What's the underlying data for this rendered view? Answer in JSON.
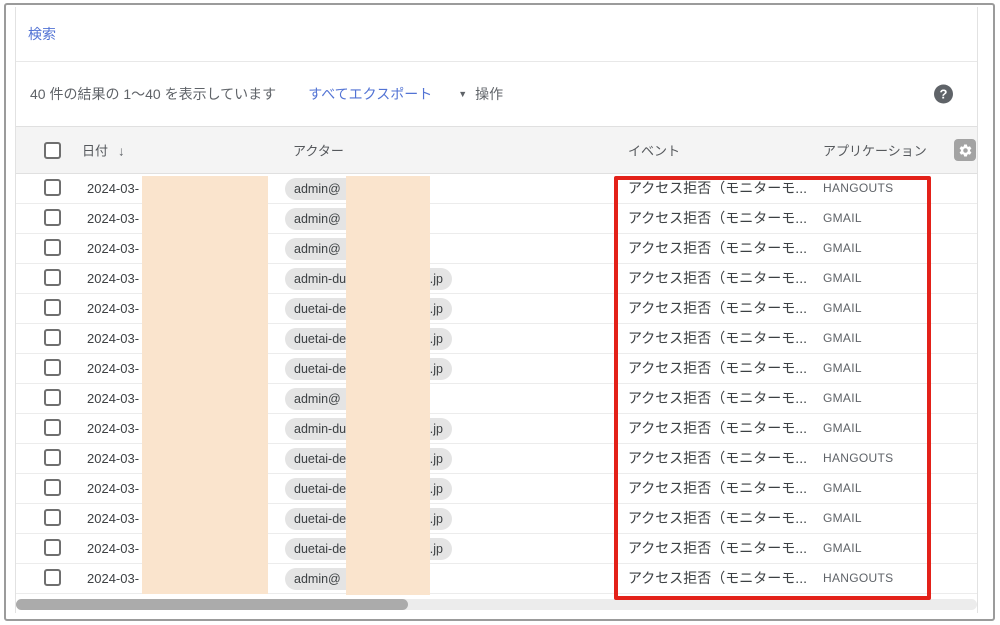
{
  "search": {
    "label": "検索"
  },
  "toolbar": {
    "results_text": "40 件の結果の 1～40 を表示しています",
    "export_label": "すべてエクスポート",
    "actions_label": "操作",
    "caret_glyph": "▼",
    "help_glyph": "?"
  },
  "table": {
    "headers": {
      "date": "日付",
      "actor": "アクター",
      "event": "イベント",
      "app": "アプリケーション"
    },
    "sort_glyph": "↓",
    "rows": [
      {
        "date": "2024-03-",
        "actor": "admin@",
        "suffix": "",
        "event": "アクセス拒否（モニターモ...",
        "app": "HANGOUTS"
      },
      {
        "date": "2024-03-",
        "actor": "admin@",
        "suffix": "",
        "event": "アクセス拒否（モニターモ...",
        "app": "GMAIL"
      },
      {
        "date": "2024-03-",
        "actor": "admin@",
        "suffix": "",
        "event": "アクセス拒否（モニターモ...",
        "app": "GMAIL"
      },
      {
        "date": "2024-03-",
        "actor": "admin-du",
        "suffix": ".jp",
        "event": "アクセス拒否（モニターモ...",
        "app": "GMAIL"
      },
      {
        "date": "2024-03-",
        "actor": "duetai-de",
        "suffix": ".jp",
        "event": "アクセス拒否（モニターモ...",
        "app": "GMAIL"
      },
      {
        "date": "2024-03-",
        "actor": "duetai-de",
        "suffix": ".jp",
        "event": "アクセス拒否（モニターモ...",
        "app": "GMAIL"
      },
      {
        "date": "2024-03-",
        "actor": "duetai-de",
        "suffix": ".jp",
        "event": "アクセス拒否（モニターモ...",
        "app": "GMAIL"
      },
      {
        "date": "2024-03-",
        "actor": "admin@",
        "suffix": "",
        "event": "アクセス拒否（モニターモ...",
        "app": "GMAIL"
      },
      {
        "date": "2024-03-",
        "actor": "admin-du",
        "suffix": ".jp",
        "event": "アクセス拒否（モニターモ...",
        "app": "GMAIL"
      },
      {
        "date": "2024-03-",
        "actor": "duetai-de",
        "suffix": ".jp",
        "event": "アクセス拒否（モニターモ...",
        "app": "HANGOUTS"
      },
      {
        "date": "2024-03-",
        "actor": "duetai-de",
        "suffix": ".jp",
        "event": "アクセス拒否（モニターモ...",
        "app": "GMAIL"
      },
      {
        "date": "2024-03-",
        "actor": "duetai-de",
        "suffix": ".jp",
        "event": "アクセス拒否（モニターモ...",
        "app": "GMAIL"
      },
      {
        "date": "2024-03-",
        "actor": "duetai-de",
        "suffix": ".jp",
        "event": "アクセス拒否（モニターモ...",
        "app": "GMAIL"
      },
      {
        "date": "2024-03-",
        "actor": "admin@",
        "suffix": "",
        "event": "アクセス拒否（モニターモ...",
        "app": "HANGOUTS"
      }
    ]
  },
  "colors": {
    "link_blue": "#5273d4",
    "highlight_red": "#e32119",
    "redaction_peach": "#fae4cd",
    "chip_gray": "#e4e4e4"
  }
}
